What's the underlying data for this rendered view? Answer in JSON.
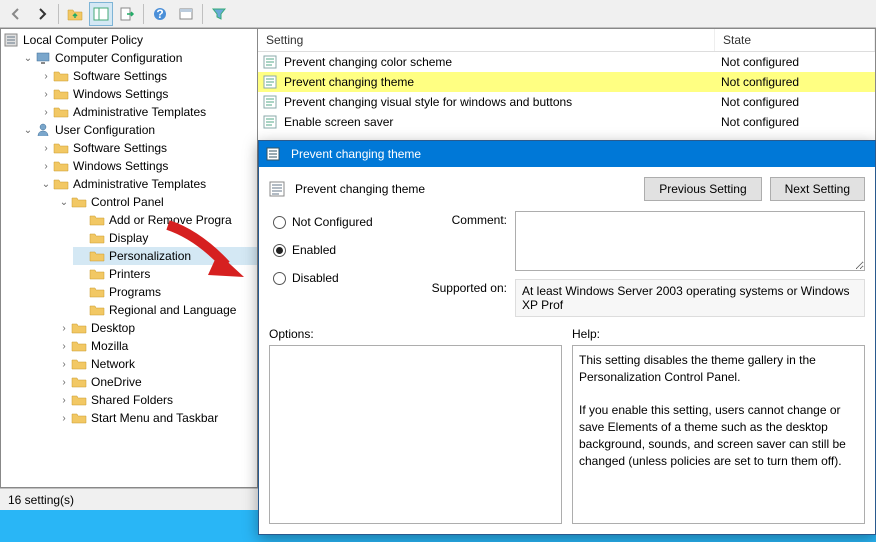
{
  "toolbar": {
    "buttons": [
      "back",
      "forward",
      "up",
      "show-hide-tree",
      "export",
      "refresh",
      "help",
      "properties",
      "filter"
    ]
  },
  "tree": {
    "root_label": "Local Computer Policy",
    "computer_config": "Computer Configuration",
    "computer_children": [
      "Software Settings",
      "Windows Settings",
      "Administrative Templates"
    ],
    "user_config": "User Configuration",
    "user_children_top": [
      "Software Settings",
      "Windows Settings"
    ],
    "admin_templates": "Administrative Templates",
    "control_panel": "Control Panel",
    "control_panel_children": [
      "Add or Remove Progra",
      "Display",
      "Personalization",
      "Printers",
      "Programs",
      "Regional and Language"
    ],
    "user_other": [
      "Desktop",
      "Mozilla",
      "Network",
      "OneDrive",
      "Shared Folders",
      "Start Menu and Taskbar"
    ],
    "selected": "Personalization"
  },
  "list": {
    "headers": {
      "setting": "Setting",
      "state": "State"
    },
    "rows": [
      {
        "name": "Prevent changing color scheme",
        "state": "Not configured",
        "highlight": false
      },
      {
        "name": "Prevent changing theme",
        "state": "Not configured",
        "highlight": true
      },
      {
        "name": "Prevent changing visual style for windows and buttons",
        "state": "Not configured",
        "highlight": false
      },
      {
        "name": "Enable screen saver",
        "state": "Not configured",
        "highlight": false
      }
    ]
  },
  "statusbar": {
    "text": "16 setting(s)"
  },
  "dialog": {
    "title": "Prevent changing theme",
    "heading": "Prevent changing theme",
    "prev_btn": "Previous Setting",
    "next_btn": "Next Setting",
    "radios": {
      "not_configured": "Not Configured",
      "enabled": "Enabled",
      "disabled": "Disabled",
      "selected": "enabled"
    },
    "comment_label": "Comment:",
    "comment_value": "",
    "supported_label": "Supported on:",
    "supported_value": "At least Windows Server 2003 operating systems or Windows XP Prof",
    "options_label": "Options:",
    "help_label": "Help:",
    "help_text": "This setting disables the theme gallery in the Personalization Control Panel.\n\nIf you enable this setting, users cannot change or save Elements of a theme such as the desktop background, sounds, and screen saver can still be changed (unless policies are set to turn them off)."
  }
}
